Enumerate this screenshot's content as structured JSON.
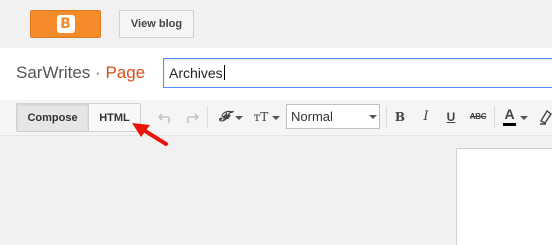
{
  "header": {
    "logo_icon": "blogger-icon",
    "view_blog_label": "View blog"
  },
  "titlebar": {
    "blog_name": "SarWrites",
    "separator": "·",
    "section": "Page",
    "page_title_value": "Archives"
  },
  "toolbar": {
    "compose_label": "Compose",
    "html_label": "HTML",
    "undo_icon": "undo-icon",
    "redo_icon": "redo-icon",
    "font_icon": "font-icon",
    "font_glyph": "𝓕",
    "font_size_icon": "font-size-icon",
    "font_size_glyph": "тT",
    "format_value": "Normal",
    "bold_glyph": "B",
    "italic_glyph": "I",
    "underline_glyph": "U",
    "strike_glyph": "ABC",
    "text_color_glyph": "A",
    "text_color": "#000000",
    "highlight_icon": "highlighter-icon"
  },
  "annotation": {
    "arrow_color": "#e8170c",
    "arrow_icon": "red-arrow-icon"
  },
  "colors": {
    "logo_orange": "#f68b2c",
    "page_word": "#dd4b14",
    "input_focus_border": "#4d90fe"
  }
}
